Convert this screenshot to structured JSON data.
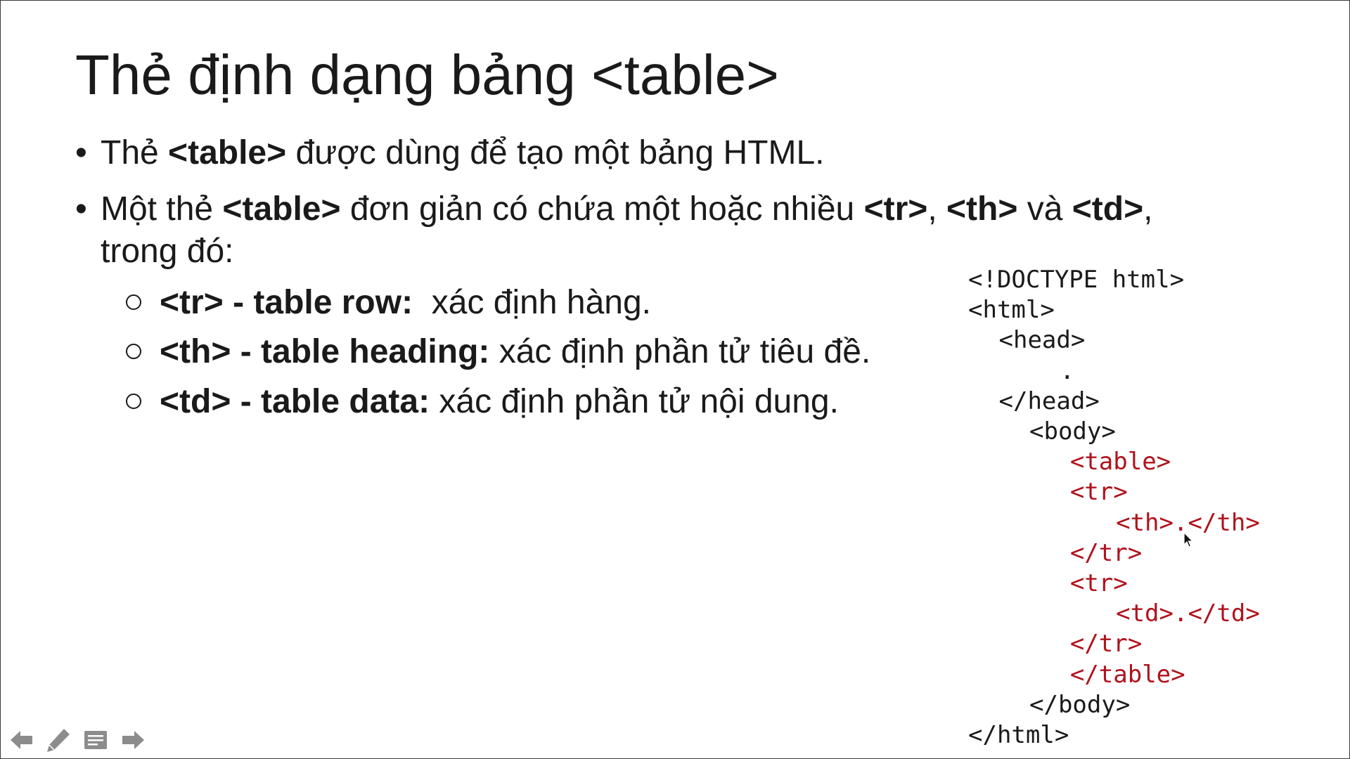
{
  "slide": {
    "title": "Thẻ định dạng bảng <table>",
    "bullets": [
      {
        "parts": [
          {
            "text": "Thẻ ",
            "bold": false
          },
          {
            "text": "<table>",
            "bold": true
          },
          {
            "text": " được dùng để tạo một bảng HTML.",
            "bold": false
          }
        ]
      },
      {
        "parts": [
          {
            "text": "Một thẻ ",
            "bold": false
          },
          {
            "text": "<table>",
            "bold": true
          },
          {
            "text": " đơn giản có chứa một hoặc nhiều ",
            "bold": false
          },
          {
            "text": "<tr>",
            "bold": true
          },
          {
            "text": ", ",
            "bold": false
          },
          {
            "text": "<th>",
            "bold": true
          },
          {
            "text": " và ",
            "bold": false
          },
          {
            "text": "<td>",
            "bold": true
          },
          {
            "text": ",",
            "bold": false
          }
        ],
        "continuation": "trong đó:"
      }
    ],
    "sub_bullets": [
      {
        "term": "<tr> - table row:",
        "desc": "  xác định hàng."
      },
      {
        "term": "<th> - table heading:",
        "desc": " xác định phần tử tiêu đề."
      },
      {
        "term": "<td> - table data:",
        "desc": " xác định phần tử nội dung."
      }
    ],
    "bullet_char": "•",
    "code_lines": [
      {
        "text": "<!DOCTYPE html>",
        "indent": 0,
        "color": "#1a1a1a"
      },
      {
        "text": "<html>",
        "indent": 0,
        "color": "#1a1a1a"
      },
      {
        "text": "<head>",
        "indent": 1,
        "color": "#1a1a1a"
      },
      {
        "text": ".",
        "indent": 3,
        "color": "#1a1a1a"
      },
      {
        "text": "</head>",
        "indent": 1,
        "color": "#1a1a1a"
      },
      {
        "text": "<body>",
        "indent": 2,
        "color": "#1a1a1a"
      },
      {
        "text": "<table>",
        "indent": 3.33,
        "color": "#b0121b"
      },
      {
        "text": "<tr>",
        "indent": 3.33,
        "color": "#b0121b"
      },
      {
        "text": "<th>.</th>",
        "indent": 4.83,
        "color": "#b0121b"
      },
      {
        "text": "</tr>",
        "indent": 3.33,
        "color": "#b0121b"
      },
      {
        "text": "<tr>",
        "indent": 3.33,
        "color": "#b0121b"
      },
      {
        "text": "<td>.</td>",
        "indent": 4.83,
        "color": "#b0121b"
      },
      {
        "text": "</tr>",
        "indent": 3.33,
        "color": "#b0121b"
      },
      {
        "text": "</table>",
        "indent": 3.33,
        "color": "#b0121b"
      },
      {
        "text": "</body>",
        "indent": 2,
        "color": "#1a1a1a"
      },
      {
        "text": "</html>",
        "indent": 0,
        "color": "#1a1a1a"
      }
    ]
  },
  "toolbar": {
    "icons": [
      "arrow-left-icon",
      "pen-icon",
      "slide-menu-icon",
      "arrow-right-icon"
    ],
    "icon_color": "#8c8c8c"
  },
  "colors": {
    "text": "#1a1a1a",
    "code_highlight": "#b0121b",
    "background": "#ffffff"
  }
}
